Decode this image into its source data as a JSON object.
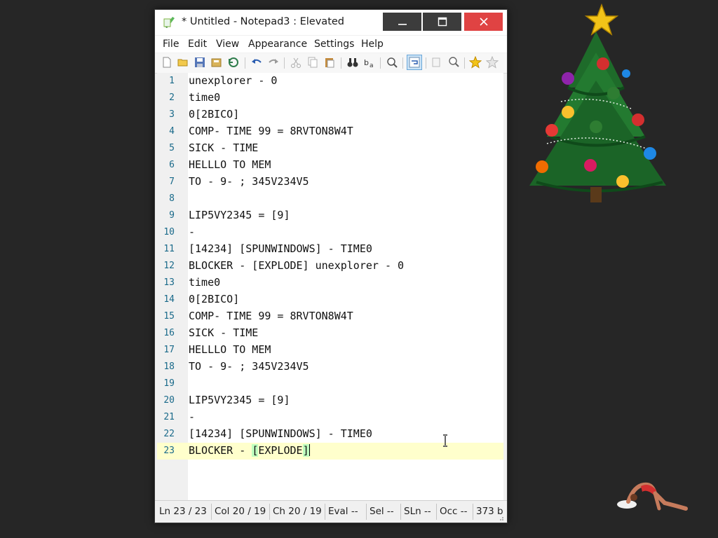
{
  "window": {
    "title": "* Untitled - Notepad3 : Elevated",
    "icon": "notepad3-app-icon"
  },
  "menu": [
    "File",
    "Edit",
    "View",
    "Appearance",
    "Settings",
    "Help"
  ],
  "toolbar_icons": [
    "new-file-icon",
    "open-folder-icon",
    "save-icon",
    "save-as-icon",
    "revert-icon",
    "undo-icon",
    "redo-icon",
    "cut-icon",
    "copy-icon",
    "paste-icon",
    "find-icon",
    "replace-icon",
    "goto-icon",
    "word-wrap-icon",
    "zoom-in-icon",
    "zoom-out-icon",
    "favorites-icon",
    "add-favorite-icon"
  ],
  "editor": {
    "current_line": 23,
    "lines": [
      {
        "n": "1",
        "text": "unexplorer - 0"
      },
      {
        "n": "2",
        "text": "time0"
      },
      {
        "n": "3",
        "text": "0[2BICO]"
      },
      {
        "n": "4",
        "text": "COMP- TIME 99 = 8RVTON8W4T"
      },
      {
        "n": "5",
        "text": "SICK - TIME"
      },
      {
        "n": "6",
        "text": "HELLLO TO MEM"
      },
      {
        "n": "7",
        "text": "TO - 9- ; 345V234V5"
      },
      {
        "n": "8",
        "text": ""
      },
      {
        "n": "9",
        "text": "LIP5VY2345 = [9]"
      },
      {
        "n": "10",
        "text": "-"
      },
      {
        "n": "11",
        "text": "[14234] [SPUNWINDOWS] - TIME0"
      },
      {
        "n": "12",
        "text": "BLOCKER - [EXPLODE] unexplorer - 0"
      },
      {
        "n": "13",
        "text": "time0"
      },
      {
        "n": "14",
        "text": "0[2BICO]"
      },
      {
        "n": "15",
        "text": "COMP- TIME 99 = 8RVTON8W4T"
      },
      {
        "n": "16",
        "text": "SICK - TIME"
      },
      {
        "n": "17",
        "text": "HELLLO TO MEM"
      },
      {
        "n": "18",
        "text": "TO - 9- ; 345V234V5"
      },
      {
        "n": "19",
        "text": ""
      },
      {
        "n": "20",
        "text": "LIP5VY2345 = [9]"
      },
      {
        "n": "21",
        "text": "-"
      },
      {
        "n": "22",
        "text": "[14234] [SPUNWINDOWS] - TIME0"
      },
      {
        "n": "23",
        "text": "BLOCKER - ",
        "hl_open": "[",
        "hl_mid": "EXPLODE",
        "hl_close": "]"
      }
    ]
  },
  "status": {
    "ln": "Ln  23 / 23",
    "col": "Col  20 / 19",
    "ch": "Ch  20 / 19",
    "eval": "Eval  --",
    "sel": "Sel  --",
    "sln": "SLn  --",
    "occ": "Occ  --",
    "size": "373 b"
  },
  "colors": {
    "close_button": "#e04343",
    "current_line": "#ffffcc",
    "brace_match": "#bfffbf",
    "line_number": "#1a6a8a",
    "desktop": "#262626"
  }
}
